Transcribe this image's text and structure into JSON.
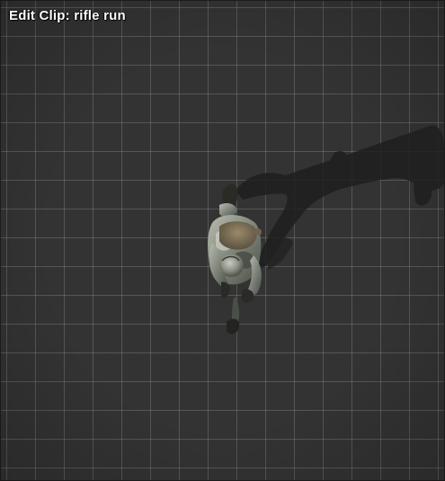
{
  "window": {
    "title": "Edit Clip: rifle run"
  },
  "viewport": {
    "background_color": "#333333",
    "grid_color": "#8f8f8f",
    "shadow_color": "#1f1f1f",
    "subject": "soldier-character-icon"
  }
}
